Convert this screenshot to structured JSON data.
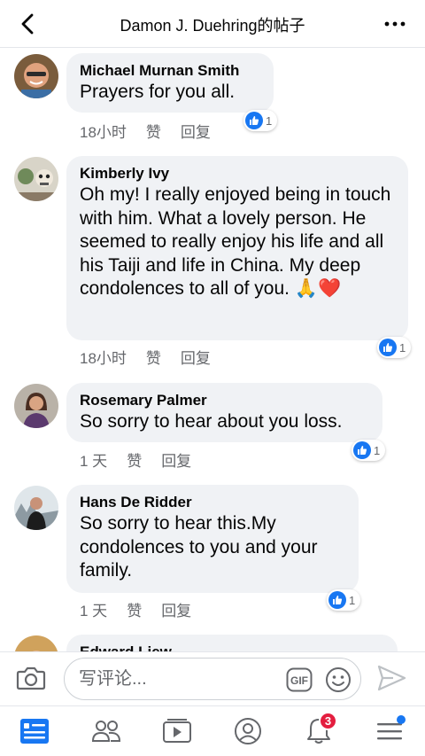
{
  "header": {
    "title": "Damon J. Duehring的帖子"
  },
  "comments": [
    {
      "author": "Michael Murnan Smith",
      "text": "Prayers for you all.",
      "time": "18小时",
      "like_label": "赞",
      "reply_label": "回复",
      "reaction_count": "1"
    },
    {
      "author": "Kimberly Ivy",
      "text": "Oh my!  I really enjoyed being in touch with him. What a lovely person. He seemed to really enjoy his life and all his Taiji and life in China. My deep condolences to all of you. 🙏❤️",
      "time": "18小时",
      "like_label": "赞",
      "reply_label": "回复",
      "reaction_count": "1"
    },
    {
      "author": "Rosemary Palmer",
      "text": "So sorry to hear about you loss.",
      "time": "1 天",
      "like_label": "赞",
      "reply_label": "回复",
      "reaction_count": "1"
    },
    {
      "author": "Hans De Ridder",
      "text": "So sorry to hear this.My condolences to you and your family.",
      "time": "1 天",
      "like_label": "赞",
      "reply_label": "回复",
      "reaction_count": "1"
    },
    {
      "author": "Edward Liew",
      "text": "",
      "time": "",
      "like_label": "",
      "reply_label": "",
      "reaction_count": ""
    }
  ],
  "composer": {
    "placeholder": "写评论...",
    "gif_label": "GIF"
  },
  "tabbar": {
    "notifications_count": "3"
  },
  "colors": {
    "accent": "#1877f2",
    "bubble": "#f0f2f5",
    "badge": "#e41e3f",
    "meta_text": "#65676b"
  }
}
